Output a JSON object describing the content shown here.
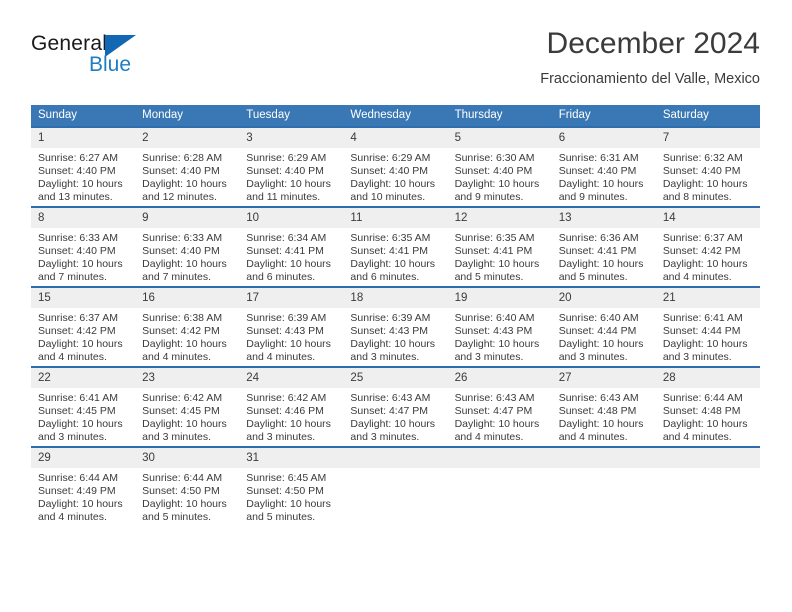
{
  "brand": {
    "name_top": "General",
    "name_bottom": "Blue",
    "accent_color": "#1f7ec2",
    "triangle_color": "#1268b3"
  },
  "header": {
    "title": "December 2024",
    "subtitle": "Fraccionamiento del Valle, Mexico"
  },
  "calendar": {
    "header_bg": "#3a78b5",
    "row_border_color": "#2f6eae",
    "daynum_bg": "#efefef",
    "weekday_headers": [
      "Sunday",
      "Monday",
      "Tuesday",
      "Wednesday",
      "Thursday",
      "Friday",
      "Saturday"
    ],
    "weeks": [
      [
        {
          "day": "1",
          "sunrise": "Sunrise: 6:27 AM",
          "sunset": "Sunset: 4:40 PM",
          "daylight_line1": "Daylight: 10 hours",
          "daylight_line2": "and 13 minutes."
        },
        {
          "day": "2",
          "sunrise": "Sunrise: 6:28 AM",
          "sunset": "Sunset: 4:40 PM",
          "daylight_line1": "Daylight: 10 hours",
          "daylight_line2": "and 12 minutes."
        },
        {
          "day": "3",
          "sunrise": "Sunrise: 6:29 AM",
          "sunset": "Sunset: 4:40 PM",
          "daylight_line1": "Daylight: 10 hours",
          "daylight_line2": "and 11 minutes."
        },
        {
          "day": "4",
          "sunrise": "Sunrise: 6:29 AM",
          "sunset": "Sunset: 4:40 PM",
          "daylight_line1": "Daylight: 10 hours",
          "daylight_line2": "and 10 minutes."
        },
        {
          "day": "5",
          "sunrise": "Sunrise: 6:30 AM",
          "sunset": "Sunset: 4:40 PM",
          "daylight_line1": "Daylight: 10 hours",
          "daylight_line2": "and 9 minutes."
        },
        {
          "day": "6",
          "sunrise": "Sunrise: 6:31 AM",
          "sunset": "Sunset: 4:40 PM",
          "daylight_line1": "Daylight: 10 hours",
          "daylight_line2": "and 9 minutes."
        },
        {
          "day": "7",
          "sunrise": "Sunrise: 6:32 AM",
          "sunset": "Sunset: 4:40 PM",
          "daylight_line1": "Daylight: 10 hours",
          "daylight_line2": "and 8 minutes."
        }
      ],
      [
        {
          "day": "8",
          "sunrise": "Sunrise: 6:33 AM",
          "sunset": "Sunset: 4:40 PM",
          "daylight_line1": "Daylight: 10 hours",
          "daylight_line2": "and 7 minutes."
        },
        {
          "day": "9",
          "sunrise": "Sunrise: 6:33 AM",
          "sunset": "Sunset: 4:40 PM",
          "daylight_line1": "Daylight: 10 hours",
          "daylight_line2": "and 7 minutes."
        },
        {
          "day": "10",
          "sunrise": "Sunrise: 6:34 AM",
          "sunset": "Sunset: 4:41 PM",
          "daylight_line1": "Daylight: 10 hours",
          "daylight_line2": "and 6 minutes."
        },
        {
          "day": "11",
          "sunrise": "Sunrise: 6:35 AM",
          "sunset": "Sunset: 4:41 PM",
          "daylight_line1": "Daylight: 10 hours",
          "daylight_line2": "and 6 minutes."
        },
        {
          "day": "12",
          "sunrise": "Sunrise: 6:35 AM",
          "sunset": "Sunset: 4:41 PM",
          "daylight_line1": "Daylight: 10 hours",
          "daylight_line2": "and 5 minutes."
        },
        {
          "day": "13",
          "sunrise": "Sunrise: 6:36 AM",
          "sunset": "Sunset: 4:41 PM",
          "daylight_line1": "Daylight: 10 hours",
          "daylight_line2": "and 5 minutes."
        },
        {
          "day": "14",
          "sunrise": "Sunrise: 6:37 AM",
          "sunset": "Sunset: 4:42 PM",
          "daylight_line1": "Daylight: 10 hours",
          "daylight_line2": "and 4 minutes."
        }
      ],
      [
        {
          "day": "15",
          "sunrise": "Sunrise: 6:37 AM",
          "sunset": "Sunset: 4:42 PM",
          "daylight_line1": "Daylight: 10 hours",
          "daylight_line2": "and 4 minutes."
        },
        {
          "day": "16",
          "sunrise": "Sunrise: 6:38 AM",
          "sunset": "Sunset: 4:42 PM",
          "daylight_line1": "Daylight: 10 hours",
          "daylight_line2": "and 4 minutes."
        },
        {
          "day": "17",
          "sunrise": "Sunrise: 6:39 AM",
          "sunset": "Sunset: 4:43 PM",
          "daylight_line1": "Daylight: 10 hours",
          "daylight_line2": "and 4 minutes."
        },
        {
          "day": "18",
          "sunrise": "Sunrise: 6:39 AM",
          "sunset": "Sunset: 4:43 PM",
          "daylight_line1": "Daylight: 10 hours",
          "daylight_line2": "and 3 minutes."
        },
        {
          "day": "19",
          "sunrise": "Sunrise: 6:40 AM",
          "sunset": "Sunset: 4:43 PM",
          "daylight_line1": "Daylight: 10 hours",
          "daylight_line2": "and 3 minutes."
        },
        {
          "day": "20",
          "sunrise": "Sunrise: 6:40 AM",
          "sunset": "Sunset: 4:44 PM",
          "daylight_line1": "Daylight: 10 hours",
          "daylight_line2": "and 3 minutes."
        },
        {
          "day": "21",
          "sunrise": "Sunrise: 6:41 AM",
          "sunset": "Sunset: 4:44 PM",
          "daylight_line1": "Daylight: 10 hours",
          "daylight_line2": "and 3 minutes."
        }
      ],
      [
        {
          "day": "22",
          "sunrise": "Sunrise: 6:41 AM",
          "sunset": "Sunset: 4:45 PM",
          "daylight_line1": "Daylight: 10 hours",
          "daylight_line2": "and 3 minutes."
        },
        {
          "day": "23",
          "sunrise": "Sunrise: 6:42 AM",
          "sunset": "Sunset: 4:45 PM",
          "daylight_line1": "Daylight: 10 hours",
          "daylight_line2": "and 3 minutes."
        },
        {
          "day": "24",
          "sunrise": "Sunrise: 6:42 AM",
          "sunset": "Sunset: 4:46 PM",
          "daylight_line1": "Daylight: 10 hours",
          "daylight_line2": "and 3 minutes."
        },
        {
          "day": "25",
          "sunrise": "Sunrise: 6:43 AM",
          "sunset": "Sunset: 4:47 PM",
          "daylight_line1": "Daylight: 10 hours",
          "daylight_line2": "and 3 minutes."
        },
        {
          "day": "26",
          "sunrise": "Sunrise: 6:43 AM",
          "sunset": "Sunset: 4:47 PM",
          "daylight_line1": "Daylight: 10 hours",
          "daylight_line2": "and 4 minutes."
        },
        {
          "day": "27",
          "sunrise": "Sunrise: 6:43 AM",
          "sunset": "Sunset: 4:48 PM",
          "daylight_line1": "Daylight: 10 hours",
          "daylight_line2": "and 4 minutes."
        },
        {
          "day": "28",
          "sunrise": "Sunrise: 6:44 AM",
          "sunset": "Sunset: 4:48 PM",
          "daylight_line1": "Daylight: 10 hours",
          "daylight_line2": "and 4 minutes."
        }
      ],
      [
        {
          "day": "29",
          "sunrise": "Sunrise: 6:44 AM",
          "sunset": "Sunset: 4:49 PM",
          "daylight_line1": "Daylight: 10 hours",
          "daylight_line2": "and 4 minutes."
        },
        {
          "day": "30",
          "sunrise": "Sunrise: 6:44 AM",
          "sunset": "Sunset: 4:50 PM",
          "daylight_line1": "Daylight: 10 hours",
          "daylight_line2": "and 5 minutes."
        },
        {
          "day": "31",
          "sunrise": "Sunrise: 6:45 AM",
          "sunset": "Sunset: 4:50 PM",
          "daylight_line1": "Daylight: 10 hours",
          "daylight_line2": "and 5 minutes."
        },
        {
          "day": "",
          "sunrise": "",
          "sunset": "",
          "daylight_line1": "",
          "daylight_line2": ""
        },
        {
          "day": "",
          "sunrise": "",
          "sunset": "",
          "daylight_line1": "",
          "daylight_line2": ""
        },
        {
          "day": "",
          "sunrise": "",
          "sunset": "",
          "daylight_line1": "",
          "daylight_line2": ""
        },
        {
          "day": "",
          "sunrise": "",
          "sunset": "",
          "daylight_line1": "",
          "daylight_line2": ""
        }
      ]
    ]
  }
}
